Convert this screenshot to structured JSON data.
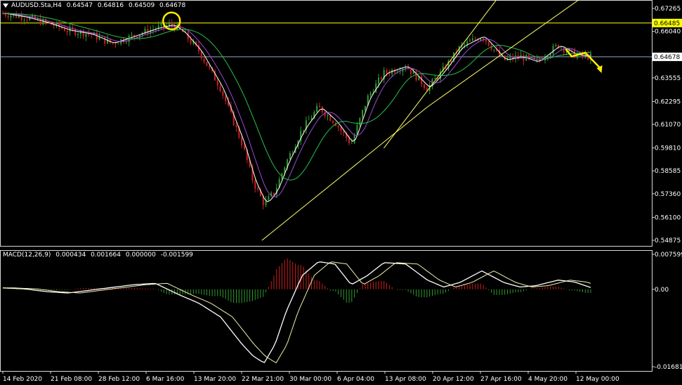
{
  "header": {
    "symbol": "AUDUSD.Sta,H4",
    "open": "0.64547",
    "high": "0.64816",
    "low": "0.64509",
    "close": "0.64678"
  },
  "macd_header": {
    "name": "MACD(12,26,9)",
    "v1": "0.000434",
    "v2": "0.001664",
    "v3": "0.000000",
    "v4": "-0.001599"
  },
  "colors": {
    "background": "#000000",
    "bull": "#2e9d2e",
    "bear": "#cc1f1f",
    "grid_line": "#ffff66",
    "h_line": "#ffff00",
    "bid_line": "#8ea7c6",
    "ma_purple": "#9b4bd6",
    "ma_green": "#27c24c",
    "ma_white": "#ffffff",
    "annotation": "#ffee00"
  },
  "chart_data": [
    {
      "type": "line",
      "title": "",
      "price_axis": [
        "0.67265",
        "0.66040",
        "0.64678",
        "0.63555",
        "0.62295",
        "0.61070",
        "0.59810",
        "0.58585",
        "0.57360",
        "0.56100",
        "0.54875"
      ],
      "price_range": [
        0.54875,
        0.67265
      ],
      "horizontal_level": "0.66485",
      "current_price": "0.64678",
      "x_labels": [
        "14 Feb 2020",
        "21 Feb 08:00",
        "28 Feb 12:00",
        "6 Mar 16:00",
        "13 Mar 20:00",
        "22 Mar 21:00",
        "30 Mar 00:00",
        "6 Apr 04:00",
        "13 Apr 08:00",
        "20 Apr 12:00",
        "27 Apr 16:00",
        "4 May 20:00",
        "12 May 00:00"
      ],
      "x": [
        0,
        4,
        8,
        12,
        16,
        20,
        24,
        28,
        31,
        33,
        36,
        40,
        42,
        44,
        46,
        48,
        50,
        52,
        55,
        58,
        61,
        64,
        67,
        70,
        74,
        78,
        81,
        84,
        88,
        92,
        95,
        98,
        102,
        105,
        108
      ],
      "series": [
        {
          "values": [
            0.67,
            0.668,
            0.665,
            0.661,
            0.659,
            0.654,
            0.658,
            0.662,
            0.664,
            0.66,
            0.65,
            0.63,
            0.615,
            0.6,
            0.58,
            0.568,
            0.575,
            0.59,
            0.608,
            0.62,
            0.612,
            0.6,
            0.625,
            0.638,
            0.642,
            0.63,
            0.64,
            0.652,
            0.658,
            0.645,
            0.647,
            0.644,
            0.653,
            0.648,
            0.6468
          ]
        }
      ]
    },
    {
      "type": "bar",
      "title": "MACD(12,26,9)",
      "y_axis": [
        "0.007599",
        "0.00",
        "-0.016813"
      ],
      "ylim": [
        -0.016813,
        0.007599
      ],
      "x": [
        0,
        4,
        8,
        12,
        16,
        20,
        24,
        28,
        31,
        33,
        36,
        40,
        42,
        44,
        46,
        48,
        50,
        52,
        55,
        58,
        61,
        64,
        67,
        70,
        74,
        78,
        81,
        84,
        88,
        92,
        95,
        98,
        102,
        105,
        108
      ],
      "series": [
        {
          "values": [
            0.0003,
            0.0001,
            -0.0005,
            -0.0008,
            -0.0002,
            0.0004,
            0.001,
            0.0013,
            -0.0004,
            -0.0015,
            -0.003,
            -0.006,
            -0.009,
            -0.012,
            -0.0145,
            -0.016,
            -0.012,
            -0.005,
            0.003,
            0.006,
            0.0055,
            0.001,
            0.003,
            0.0058,
            0.0055,
            0.002,
            0.0005,
            0.0015,
            0.004,
            0.0015,
            0.0005,
            0.0008,
            0.002,
            0.0016,
            0.0004
          ]
        }
      ]
    }
  ]
}
